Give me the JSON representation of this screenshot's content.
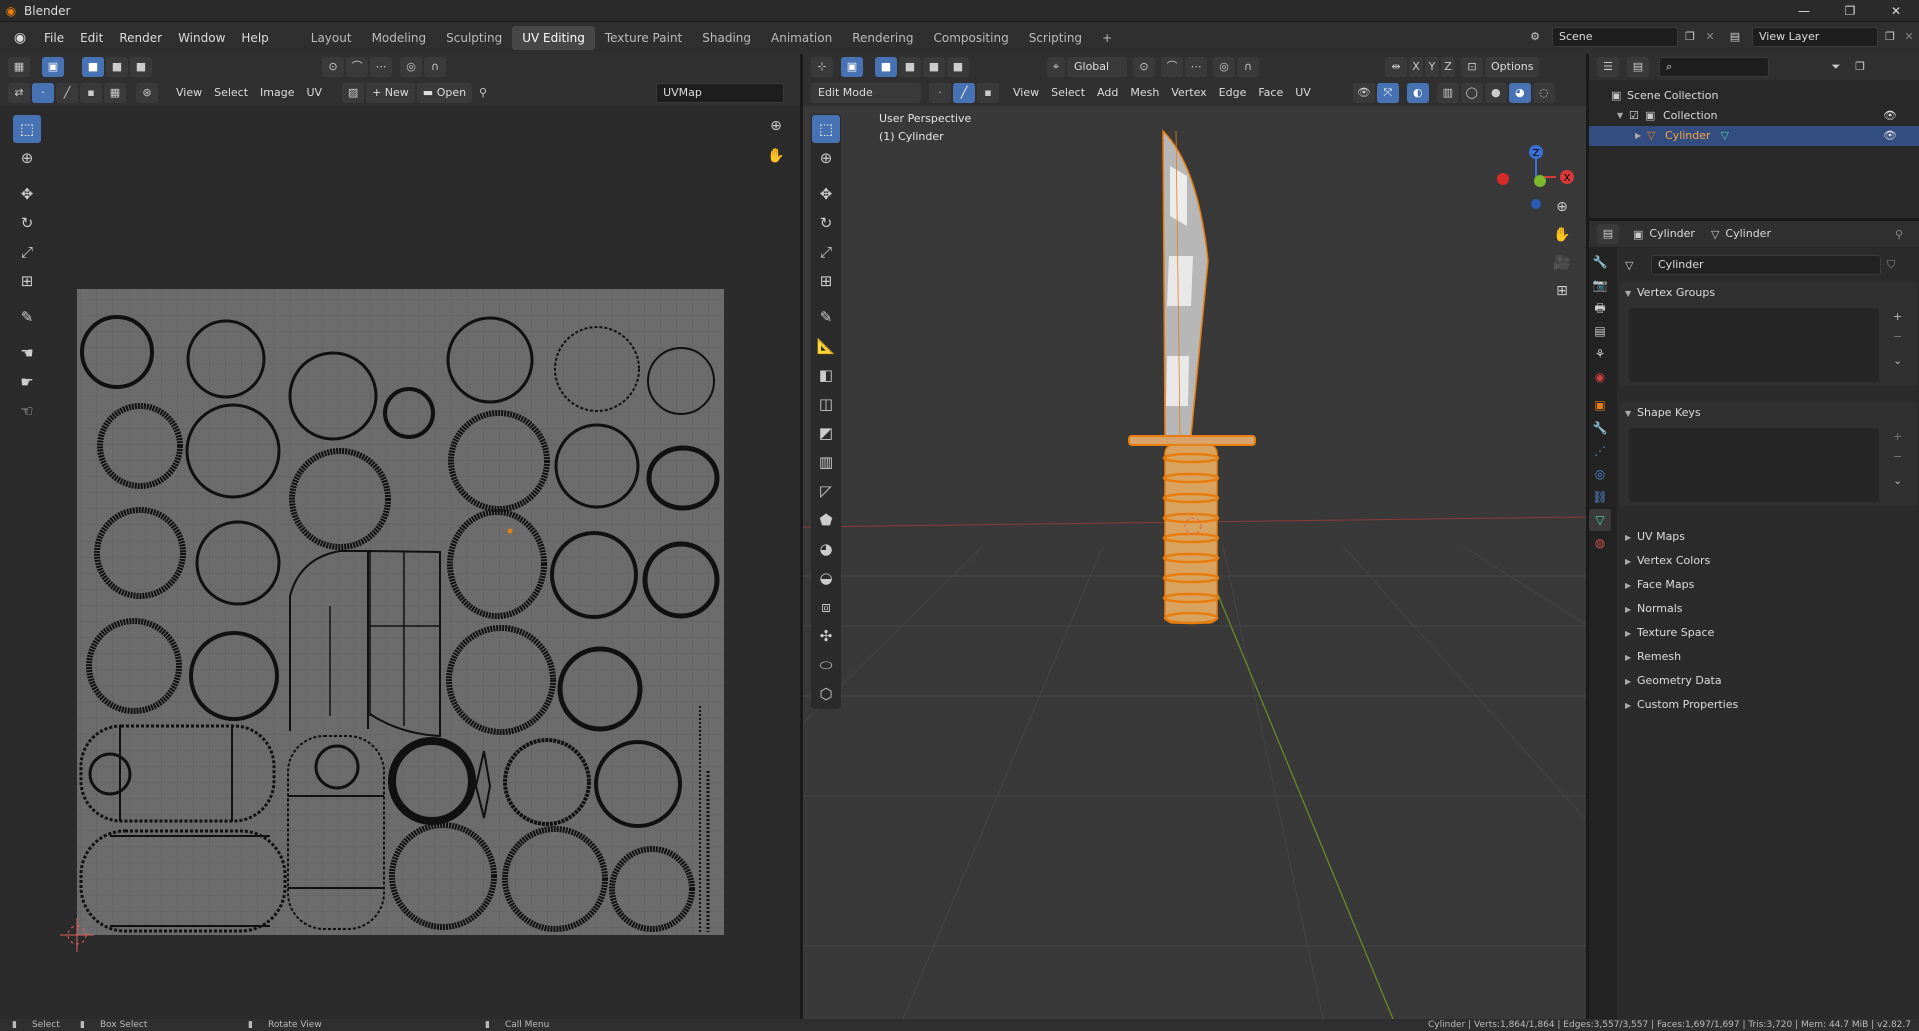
{
  "window": {
    "title": "Blender"
  },
  "menu": [
    "File",
    "Edit",
    "Render",
    "Window",
    "Help"
  ],
  "workspaces": [
    "Layout",
    "Modeling",
    "Sculpting",
    "UV Editing",
    "Texture Paint",
    "Shading",
    "Animation",
    "Rendering",
    "Compositing",
    "Scripting"
  ],
  "active_workspace": "UV Editing",
  "scene": {
    "label": "Scene",
    "view_layer": "View Layer"
  },
  "uv_editor": {
    "menus": [
      "View",
      "Select",
      "Image",
      "UV"
    ],
    "new_label": "New",
    "open_label": "Open",
    "uvmap": "UVMap"
  },
  "viewport": {
    "orientation": "Global",
    "options_label": "Options",
    "mode": "Edit Mode",
    "menus": [
      "View",
      "Select",
      "Add",
      "Mesh",
      "Vertex",
      "Edge",
      "Face",
      "UV"
    ],
    "axes": [
      "X",
      "Y",
      "Z"
    ],
    "overlay_title": "User Perspective",
    "overlay_object": "(1) Cylinder",
    "gizmo": {
      "z": "Z",
      "x": "X"
    }
  },
  "outliner": {
    "items": [
      {
        "label": "Scene Collection"
      },
      {
        "label": "Collection"
      },
      {
        "label": "Cylinder"
      }
    ]
  },
  "properties": {
    "breadcrumb_object": "Cylinder",
    "breadcrumb_data": "Cylinder",
    "data_name": "Cylinder",
    "panels_open": [
      "Vertex Groups",
      "Shape Keys"
    ],
    "panels_closed": [
      "UV Maps",
      "Vertex Colors",
      "Face Maps",
      "Normals",
      "Texture Space",
      "Remesh",
      "Geometry Data",
      "Custom Properties"
    ]
  },
  "statusbar": {
    "select": "Select",
    "box_select": "Box Select",
    "rotate_view": "Rotate View",
    "call_menu": "Call Menu",
    "stats": "Cylinder | Verts:1,864/1,864 | Edges:3,557/3,557 | Faces:1,697/1,697 | Tris:3,720 | Mem: 44.7 MiB | v2.82.7"
  },
  "colors": {
    "accent": "#4772b3",
    "selection": "#e87d0d",
    "background": "#393939"
  }
}
